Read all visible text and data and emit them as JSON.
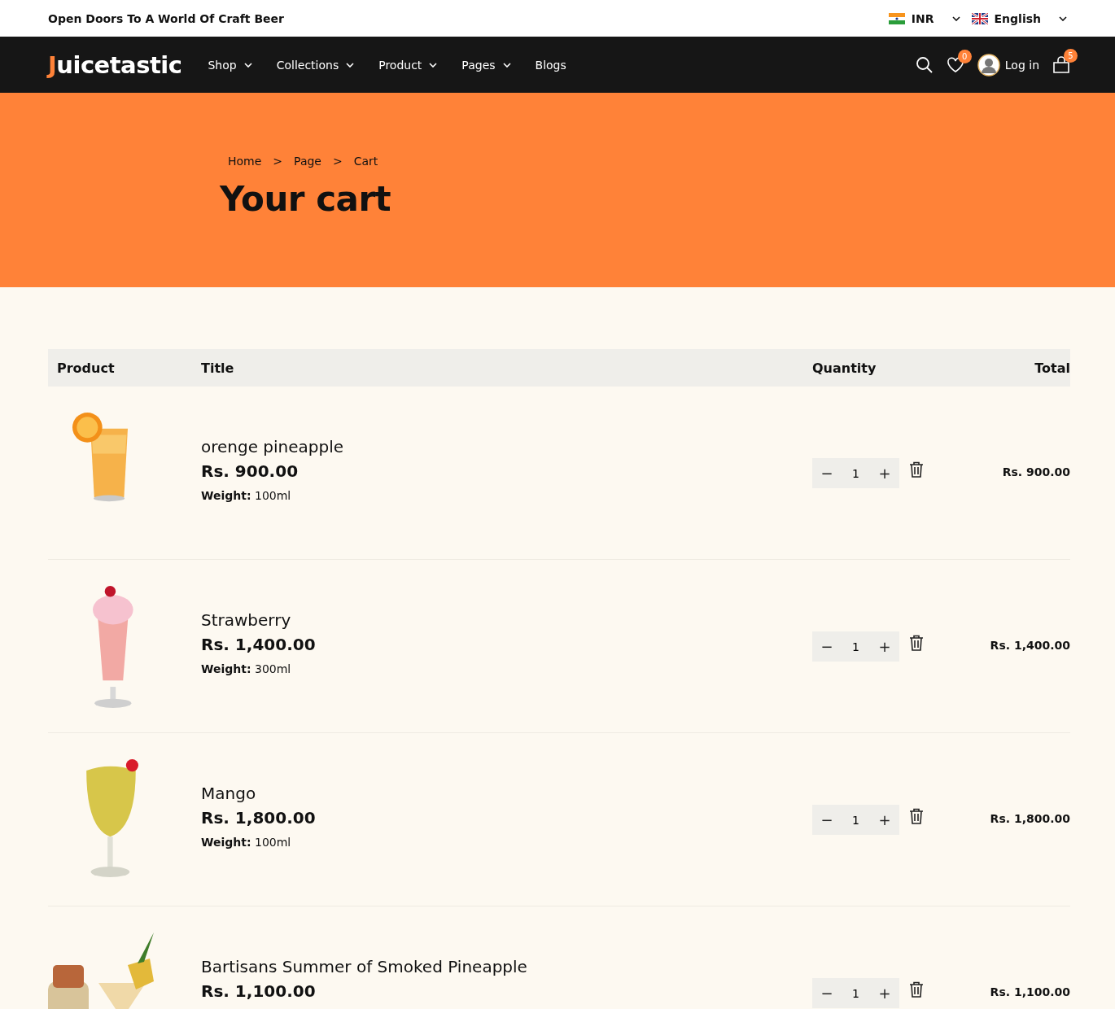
{
  "topbar": {
    "tagline": "Open Doors To A World Of Craft Beer",
    "currency": "INR",
    "language": "English"
  },
  "nav": {
    "logo_initial": "J",
    "logo_rest": "uicetastic",
    "items": [
      {
        "label": "Shop",
        "dropdown": true
      },
      {
        "label": "Collections",
        "dropdown": true
      },
      {
        "label": "Product",
        "dropdown": true
      },
      {
        "label": "Pages",
        "dropdown": true
      },
      {
        "label": "Blogs",
        "dropdown": false
      }
    ],
    "wishlist_count": "0",
    "login": "Log in",
    "cart_count": "5"
  },
  "hero": {
    "breadcrumb": [
      "Home",
      "Page",
      "Cart"
    ],
    "separator": ">",
    "title": "Your cart"
  },
  "table": {
    "columns": [
      "Product",
      "Title",
      "Quantity",
      "Total"
    ],
    "rows": [
      {
        "title": "orenge pineapple",
        "price": "Rs. 900.00",
        "weight_label": "Weight:",
        "weight": "100ml",
        "quantity": "1",
        "total": "Rs. 900.00"
      },
      {
        "title": "Strawberry",
        "price": "Rs. 1,400.00",
        "weight_label": "Weight:",
        "weight": "300ml",
        "quantity": "1",
        "total": "Rs. 1,400.00"
      },
      {
        "title": "Mango",
        "price": "Rs. 1,800.00",
        "weight_label": "Weight:",
        "weight": "100ml",
        "quantity": "1",
        "total": "Rs. 1,800.00"
      },
      {
        "title": "Bartisans Summer of Smoked Pineapple",
        "price": "Rs. 1,100.00",
        "quantity": "1",
        "total": "Rs. 1,100.00"
      }
    ],
    "minus": "−",
    "plus": "+"
  }
}
